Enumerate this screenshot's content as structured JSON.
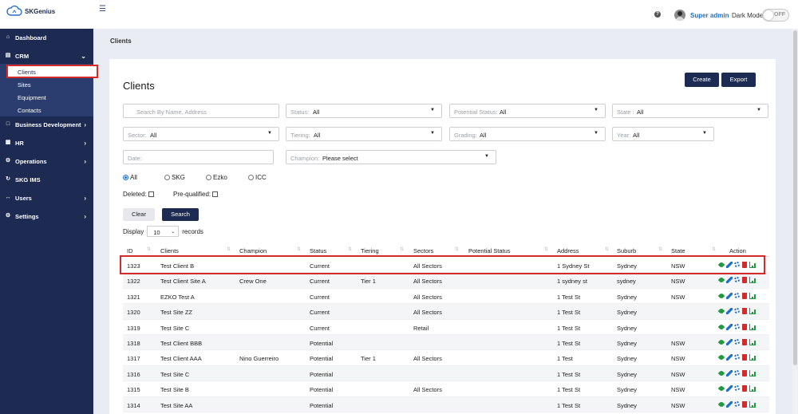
{
  "brand": {
    "name": "SKGenius"
  },
  "header": {
    "help": "?",
    "user": "Super admin",
    "dark_mode_label": "Dark Mode",
    "toggle_state": "OFF"
  },
  "sidebar": {
    "items": [
      {
        "label": "Dashboard",
        "icon": "home-icon"
      },
      {
        "label": "CRM",
        "icon": "table-icon"
      },
      {
        "label": "Business Development",
        "icon": "folder-icon"
      },
      {
        "label": "HR",
        "icon": "id-card-icon"
      },
      {
        "label": "Operations",
        "icon": "gear-icon"
      },
      {
        "label": "SKG IMS",
        "icon": "refresh-icon"
      },
      {
        "label": "Users",
        "icon": "users-icon"
      },
      {
        "label": "Settings",
        "icon": "cog-icon"
      }
    ],
    "crm_sub": [
      "Clients",
      "Sites",
      "Equipment",
      "Contacts"
    ]
  },
  "breadcrumb": "Clients",
  "page": {
    "title": "Clients",
    "create": "Create",
    "export": "Export"
  },
  "filters": {
    "search_placeholder": "Search By Name, Address",
    "status": {
      "label": "Status:",
      "value": "All"
    },
    "potential_status": {
      "label": "Potential Status:",
      "value": "All"
    },
    "state": {
      "label": "State :",
      "value": "All"
    },
    "sector": {
      "label": "Sector:",
      "value": "All"
    },
    "tiering": {
      "label": "Tiering:",
      "value": "All"
    },
    "grading": {
      "label": "Grading:",
      "value": "All"
    },
    "year": {
      "label": "Year:",
      "value": "All"
    },
    "date_placeholder": "Date:",
    "champion": {
      "label": "Champion:",
      "value": "Please select"
    },
    "radios": [
      "All",
      "SKG",
      "Ezko",
      "ICC"
    ],
    "deleted_label": "Deleted:",
    "prequalified_label": "Pre-qualified:",
    "clear": "Clear",
    "search": "Search",
    "display_label": "Display",
    "display_value": "10",
    "records_label": "records"
  },
  "table": {
    "columns": [
      "ID",
      "Clients",
      "Champion",
      "Status",
      "Tiering",
      "Sectors",
      "Potential Status",
      "Address",
      "Suburb",
      "State",
      "Action"
    ],
    "rows": [
      [
        "1323",
        "Test Client B",
        "",
        "Current",
        "",
        "All Sectors",
        "",
        "1 Sydney St",
        "Sydney",
        "NSW"
      ],
      [
        "1322",
        "Test Client Site A",
        "Crew One",
        "Current",
        "Tier 1",
        "All Sectors",
        "",
        "1 sydney st",
        "sydney",
        "NSW"
      ],
      [
        "1321",
        "EZKO Test A",
        "",
        "Current",
        "",
        "All Sectors",
        "",
        "1 Test St",
        "Sydney",
        "NSW"
      ],
      [
        "1320",
        "Test Site ZZ",
        "",
        "Current",
        "",
        "All Sectors",
        "",
        "1 Test St",
        "Sydney",
        ""
      ],
      [
        "1319",
        "Test Site C",
        "",
        "Current",
        "",
        "Retail",
        "",
        "1 Test St",
        "Sydney",
        ""
      ],
      [
        "1318",
        "Test Client BBB",
        "",
        "Potential",
        "",
        "",
        "",
        "1 Test St",
        "Sydney",
        "NSW"
      ],
      [
        "1317",
        "Test Client AAA",
        "Nino Guerreiro",
        "Potential",
        "Tier 1",
        "All Sectors",
        "",
        "1 Test",
        "Sydney",
        "NSW"
      ],
      [
        "1316",
        "Test Site C",
        "",
        "Potential",
        "",
        "",
        "",
        "1 Test St",
        "Sydney",
        "NSW"
      ],
      [
        "1315",
        "Test Site B",
        "",
        "Potential",
        "",
        "All Sectors",
        "",
        "1 Test St",
        "Sydney",
        "NSW"
      ],
      [
        "1314",
        "Test Site AA",
        "",
        "Potential",
        "",
        "",
        "",
        "1 Test St",
        "Sydney",
        "NSW"
      ]
    ]
  }
}
